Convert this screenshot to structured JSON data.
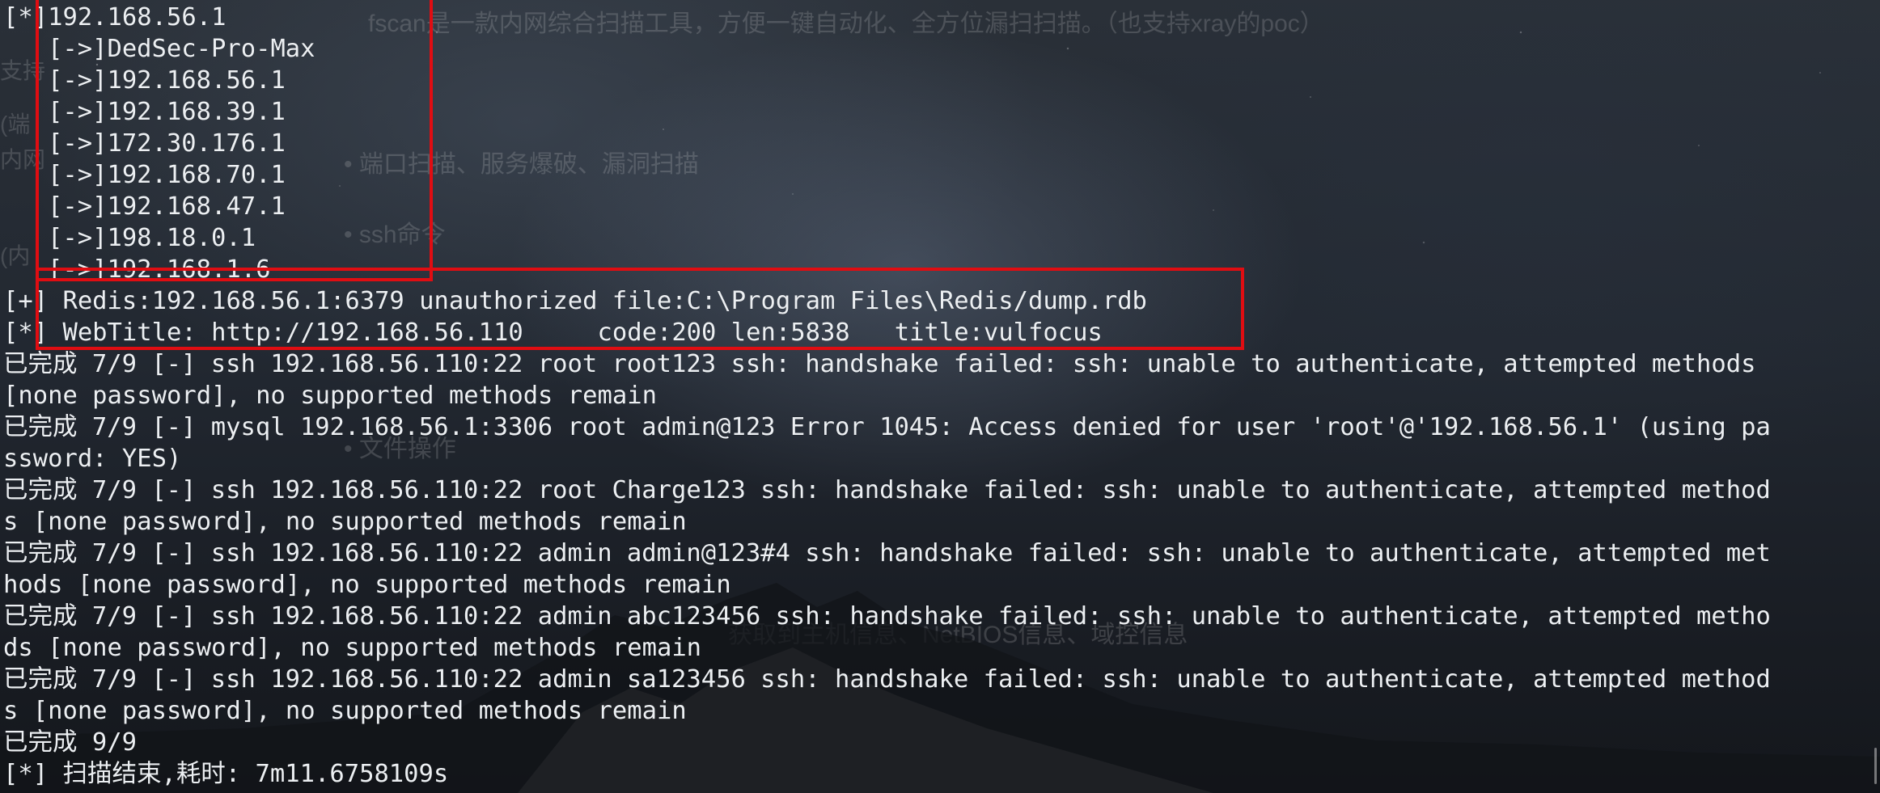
{
  "window": {
    "type": "terminal-output",
    "accent_color": "#e00d12",
    "text_color": "#eceff2"
  },
  "background_faint_text": [
    "fscan是一款内网综合扫描工具，方便一键自动化、全方位漏扫扫描。（也支持xray的poc）",
    "支持",
    "(端",
    "内网",
    "• 端口扫描、服务爆破、漏洞扫描",
    "• ssh命令",
    "(内",
    "• 文件操作",
    "获取到主机信息、NetBIOS信息、域控信息"
  ],
  "lines": {
    "host_header": "[*]192.168.56.1",
    "interfaces": [
      "[->]DedSec-Pro-Max",
      "[->]192.168.56.1",
      "[->]192.168.39.1",
      "[->]172.30.176.1",
      "[->]192.168.70.1",
      "[->]192.168.47.1",
      "[->]198.18.0.1",
      "[->]192.168.1.6"
    ],
    "redis": "[+] Redis:192.168.56.1:6379 unauthorized file:C:\\Program Files\\Redis/dump.rdb",
    "webtitle": "[*] WebTitle: http://192.168.56.110     code:200 len:5838   title:vulfocus",
    "log": [
      "已完成 7/9 [-] ssh 192.168.56.110:22 root root123 ssh: handshake failed: ssh: unable to authenticate, attempted methods",
      "[none password], no supported methods remain",
      "已完成 7/9 [-] mysql 192.168.56.1:3306 root admin@123 Error 1045: Access denied for user 'root'@'192.168.56.1' (using pa",
      "ssword: YES)",
      "已完成 7/9 [-] ssh 192.168.56.110:22 root Charge123 ssh: handshake failed: ssh: unable to authenticate, attempted method",
      "s [none password], no supported methods remain",
      "已完成 7/9 [-] ssh 192.168.56.110:22 admin admin@123#4 ssh: handshake failed: ssh: unable to authenticate, attempted met",
      "hods [none password], no supported methods remain",
      "已完成 7/9 [-] ssh 192.168.56.110:22 admin abc123456 ssh: handshake failed: ssh: unable to authenticate, attempted metho",
      "ds [none password], no supported methods remain",
      "已完成 7/9 [-] ssh 192.168.56.110:22 admin sa123456 ssh: handshake failed: ssh: unable to authenticate, attempted method",
      "s [none password], no supported methods remain",
      "已完成 9/9",
      "[*] 扫描结束,耗时: 7m11.6758109s"
    ]
  }
}
